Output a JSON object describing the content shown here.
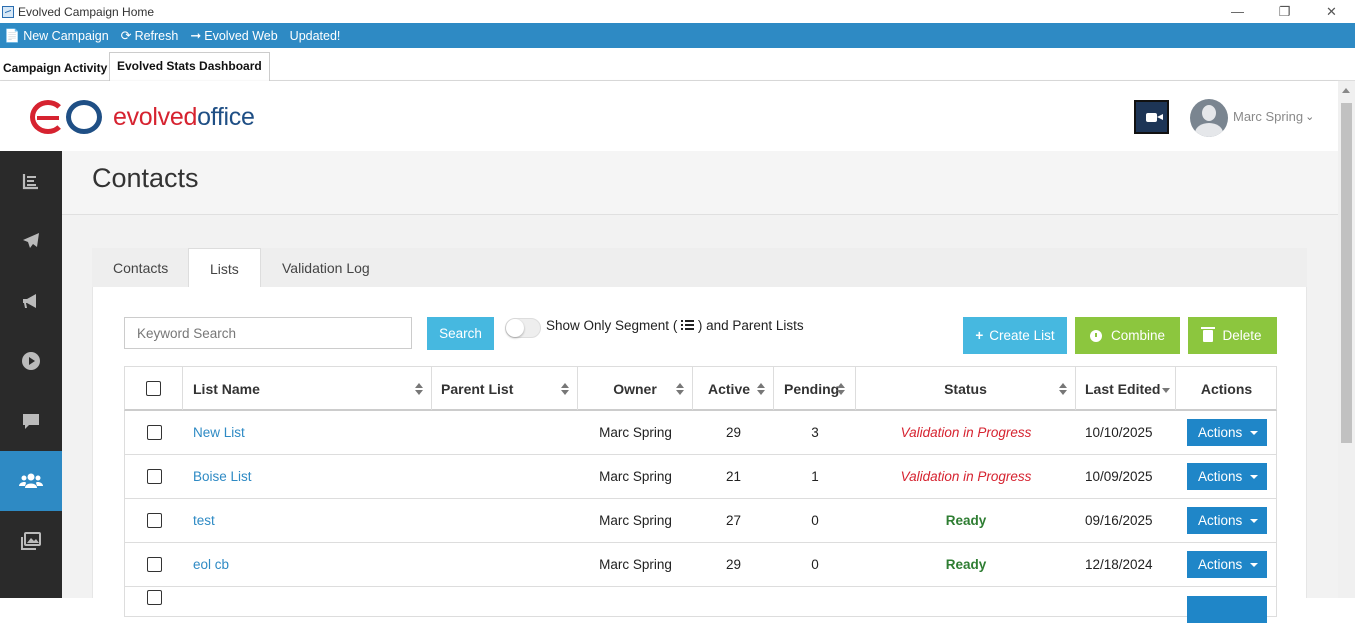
{
  "window": {
    "title": "Evolved Campaign Home",
    "minimize": "—",
    "restore": "❐",
    "close": "✕"
  },
  "toolbar": {
    "new_campaign": "New Campaign",
    "refresh": "Refresh",
    "evolved_web": "Evolved Web",
    "updated": "Updated!"
  },
  "app_tabs": {
    "campaign_activity": "Campaign Activity",
    "stats_dashboard": "Evolved Stats Dashboard"
  },
  "brand": {
    "part1": "evolved",
    "part2": "office",
    "red": "#d62330",
    "blue": "#1f4f85"
  },
  "user": {
    "name": "Marc Spring"
  },
  "page": {
    "title": "Contacts"
  },
  "content_tabs": {
    "contacts": "Contacts",
    "lists": "Lists",
    "validation_log": "Validation Log"
  },
  "controls": {
    "search_placeholder": "Keyword Search",
    "search_button": "Search",
    "toggle_label_pre": "Show Only Segment (",
    "toggle_label_post": ") and Parent Lists",
    "create_list": "Create List",
    "combine": "Combine",
    "delete": "Delete"
  },
  "table": {
    "headers": {
      "list_name": "List Name",
      "parent_list": "Parent List",
      "owner": "Owner",
      "active": "Active",
      "pending": "Pending",
      "status": "Status",
      "last_edited": "Last Edited",
      "actions": "Actions"
    },
    "rows": [
      {
        "name": "New List",
        "parent": "",
        "owner": "Marc Spring",
        "active": "29",
        "pending": "3",
        "status": "Validation in Progress",
        "edited": "10/10/2025",
        "action": "Actions"
      },
      {
        "name": "Boise List",
        "parent": "",
        "owner": "Marc Spring",
        "active": "21",
        "pending": "1",
        "status": "Validation in Progress",
        "edited": "10/09/2025",
        "action": "Actions"
      },
      {
        "name": "test",
        "parent": "",
        "owner": "Marc Spring",
        "active": "27",
        "pending": "0",
        "status": "Ready",
        "edited": "09/16/2025",
        "action": "Actions"
      },
      {
        "name": "eol cb",
        "parent": "",
        "owner": "Marc Spring",
        "active": "29",
        "pending": "0",
        "status": "Ready",
        "edited": "12/18/2024",
        "action": "Actions"
      }
    ]
  },
  "colors": {
    "toolbar": "#2e8ac4",
    "nav_active": "#2e8ac4",
    "nav_bg": "#2a2a2a",
    "green_button": "#8cc63e",
    "cyan_button": "#46b8e0"
  }
}
